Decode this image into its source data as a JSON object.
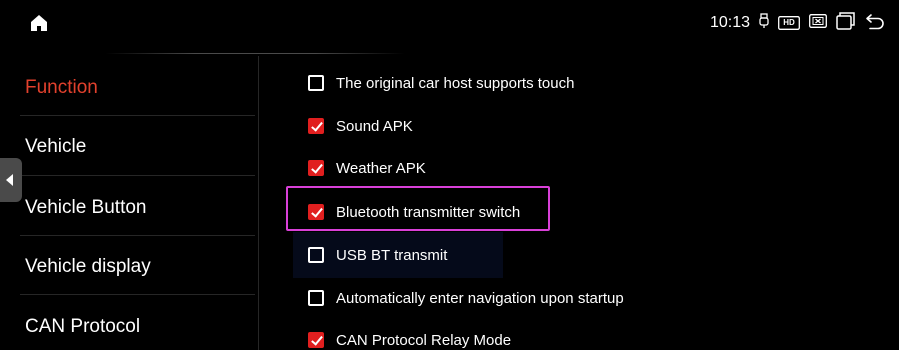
{
  "status": {
    "time": "10:13",
    "hd_label": "HD",
    "icons": [
      "usb-plug-icon",
      "hd-icon",
      "close-box-icon",
      "recent-apps-icon",
      "back-icon"
    ]
  },
  "menu": {
    "items": [
      {
        "label": "Function",
        "active": true
      },
      {
        "label": "Vehicle",
        "active": false
      },
      {
        "label": "Vehicle Button",
        "active": false
      },
      {
        "label": "Vehicle display",
        "active": false
      },
      {
        "label": "CAN Protocol",
        "active": false
      }
    ]
  },
  "options": [
    {
      "label": "The original car host supports touch",
      "checked": false
    },
    {
      "label": "Sound APK",
      "checked": true
    },
    {
      "label": "Weather APK",
      "checked": true
    },
    {
      "label": "Bluetooth transmitter switch",
      "checked": true,
      "highlighted": true
    },
    {
      "label": "USB BT transmit",
      "checked": false
    },
    {
      "label": "Automatically enter navigation upon startup",
      "checked": false
    },
    {
      "label": "CAN Protocol Relay Mode",
      "checked": true
    }
  ],
  "colors": {
    "active_menu": "#e2412d",
    "checkbox_checked": "#e11f1f",
    "highlight_border": "#d940d8"
  }
}
